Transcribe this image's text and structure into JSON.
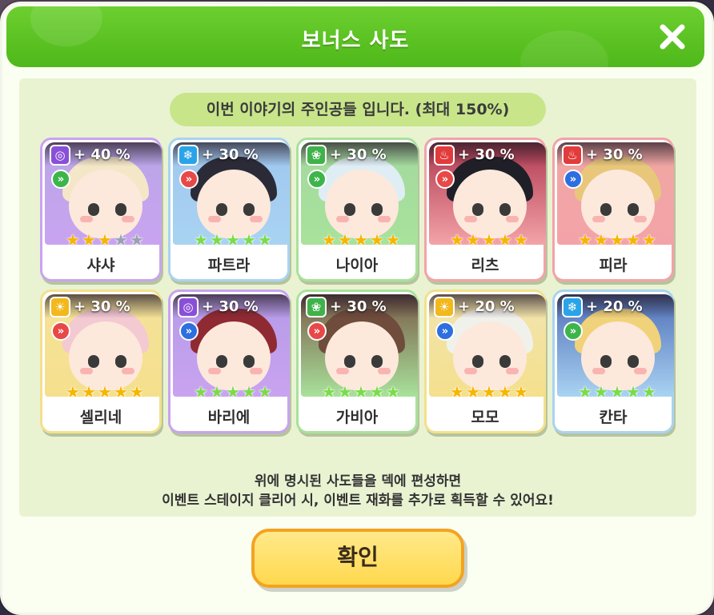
{
  "dialog": {
    "title": "보너스 사도",
    "notice": "이번 이야기의 주인공들 입니다. (최대 150%)",
    "footer_line1": "위에 명시된 사도들을 덱에 편성하면",
    "footer_line2": "이벤트 스테이지 클리어 시, 이벤트 재화를 추가로 획득할 수 있어요!",
    "confirm_label": "확인",
    "close_icon": "close-icon"
  },
  "colors": {
    "header_green": "#5cc423",
    "panel": "#e9f3d2",
    "notice": "#c8e58a",
    "button_fill": "#ffd84d",
    "button_border": "#f3a321"
  },
  "characters": [
    {
      "name": "샤샤",
      "bonus": "+ 40 %",
      "element": "vortex",
      "element_color": "#8a4fd8",
      "role_color": "#3db54a",
      "stars_filled": 3,
      "stars_total": 5,
      "star_color": "#f7b500",
      "frame": "#c9a3f0",
      "bg": "#b9a6e8",
      "hair": "#f4e7c8"
    },
    {
      "name": "파트라",
      "bonus": "+ 30 %",
      "element": "water",
      "element_color": "#2aa4e8",
      "role_color": "#e84848",
      "stars_filled": 5,
      "stars_total": 5,
      "star_color": "#7bdc4a",
      "frame": "#a9d3f2",
      "bg": "#9fc7ef",
      "hair": "#2b2b38"
    },
    {
      "name": "나이아",
      "bonus": "+ 30 %",
      "element": "nature",
      "element_color": "#3fb24a",
      "role_color": "#3db54a",
      "stars_filled": 5,
      "stars_total": 5,
      "star_color": "#f7b500",
      "frame": "#a8e29b",
      "bg": "#a4d9a0",
      "hair": "#dfeef4"
    },
    {
      "name": "리츠",
      "bonus": "+ 30 %",
      "element": "fire",
      "element_color": "#e23b3b",
      "role_color": "#e84848",
      "stars_filled": 5,
      "stars_total": 5,
      "star_color": "#f7b500",
      "frame": "#f3a3a8",
      "bg": "#b03850",
      "hair": "#1f1f28"
    },
    {
      "name": "피라",
      "bonus": "+ 30 %",
      "element": "fire",
      "element_color": "#e23b3b",
      "role_color": "#2d6fe0",
      "stars_filled": 5,
      "stars_total": 5,
      "star_color": "#f7b500",
      "frame": "#f3a3a8",
      "bg": "#f0a7a3",
      "hair": "#e8c77a"
    },
    {
      "name": "셀리네",
      "bonus": "+ 30 %",
      "element": "light",
      "element_color": "#f2b81c",
      "role_color": "#e84848",
      "stars_filled": 5,
      "stars_total": 5,
      "star_color": "#f7b500",
      "frame": "#f4e08c",
      "bg": "#f6e29a",
      "hair": "#f3c9d2"
    },
    {
      "name": "바리에",
      "bonus": "+ 30 %",
      "element": "vortex",
      "element_color": "#8a4fd8",
      "role_color": "#2d6fe0",
      "stars_filled": 5,
      "stars_total": 5,
      "star_color": "#7bdc4a",
      "frame": "#c9a3f0",
      "bg": "#b59be8",
      "hair": "#8f2a33"
    },
    {
      "name": "가비아",
      "bonus": "+ 30 %",
      "element": "nature",
      "element_color": "#3fb24a",
      "role_color": "#e84848",
      "stars_filled": 5,
      "stars_total": 5,
      "star_color": "#7bdc4a",
      "frame": "#a8e29b",
      "bg": "#7a5a48",
      "hair": "#6f4c3c"
    },
    {
      "name": "모모",
      "bonus": "+ 20 %",
      "element": "light",
      "element_color": "#f2b81c",
      "role_color": "#2d6fe0",
      "stars_filled": 5,
      "stars_total": 5,
      "star_color": "#f7b500",
      "frame": "#f4e08c",
      "bg": "#f2e4b0",
      "hair": "#f1f1ec"
    },
    {
      "name": "칸타",
      "bonus": "+ 20 %",
      "element": "water",
      "element_color": "#2aa4e8",
      "role_color": "#3db54a",
      "stars_filled": 5,
      "stars_total": 5,
      "star_color": "#7bdc4a",
      "frame": "#a9d3f2",
      "bg": "#4f6fb8",
      "hair": "#f0d27a"
    }
  ]
}
